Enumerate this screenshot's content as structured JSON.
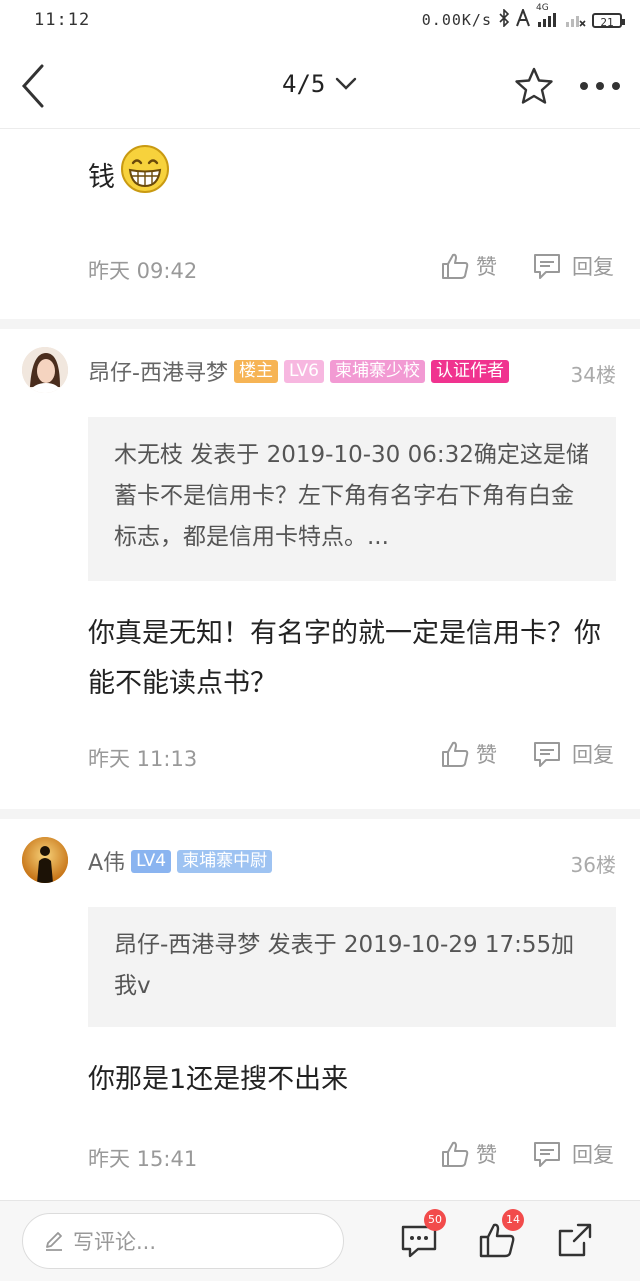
{
  "status_bar": {
    "time": "11:12",
    "network_speed": "0.00K/s",
    "signal": "4G",
    "battery": "21"
  },
  "nav": {
    "page_indicator": "4/5"
  },
  "posts": [
    {
      "text": "钱",
      "time": "昨天 09:42",
      "like_label": "赞",
      "reply_label": "回复"
    },
    {
      "username": "昂仔-西港寻梦",
      "tags": [
        "楼主",
        "LV6",
        "柬埔寨少校",
        "认证作者"
      ],
      "floor": "34楼",
      "quote": "木无枝 发表于 2019-10-30 06:32确定这是储蓄卡不是信用卡？左下角有名字右下角有白金标志，都是信用卡特点。...",
      "text": "你真是无知！有名字的就一定是信用卡？你能不能读点书？",
      "time": "昨天 11:13",
      "like_label": "赞",
      "reply_label": "回复"
    },
    {
      "username": "A伟",
      "tags": [
        "LV4",
        "柬埔寨中尉"
      ],
      "floor": "36楼",
      "quote": "昂仔-西港寻梦 发表于 2019-10-29 17:55加我v",
      "text": "你那是1还是搜不出来",
      "time": "昨天 15:41",
      "like_label": "赞",
      "reply_label": "回复"
    }
  ],
  "bottom_bar": {
    "comment_placeholder": "写评论...",
    "comments_count": "50",
    "likes_count": "14"
  },
  "colors": {
    "tag_owner": "#f6b455",
    "tag_level_pink": "#f7b7e0",
    "tag_rank_pink": "#f29ad3",
    "tag_author": "#f0338f",
    "tag_level_blue": "#8ab4f0",
    "tag_rank_blue": "#9ec3f2",
    "badge_red": "#f24b4b"
  }
}
